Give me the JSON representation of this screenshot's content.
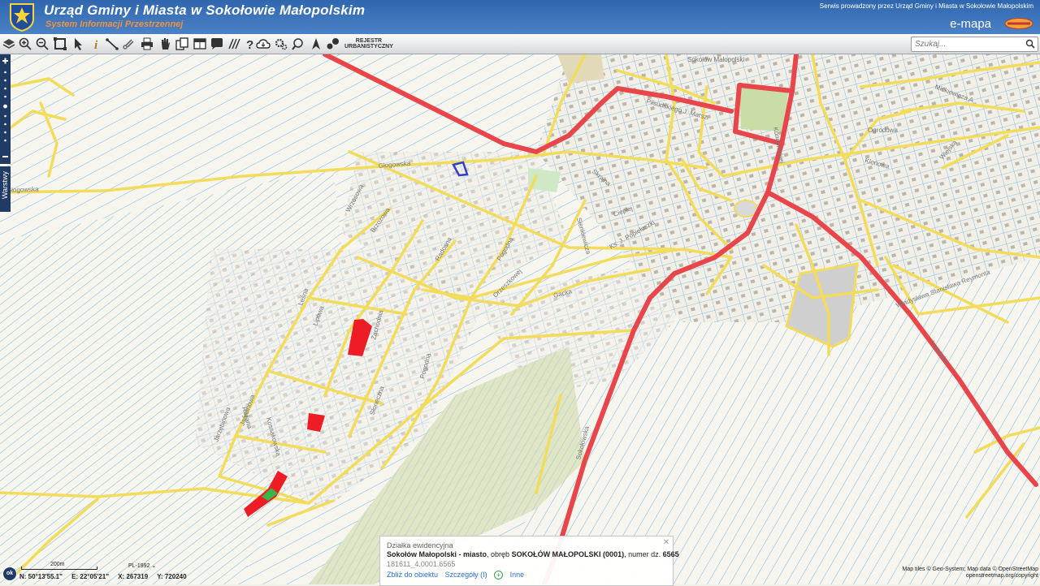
{
  "header": {
    "title": "Urząd Gminy i Miasta w Sokołowie Małopolskim",
    "subtitle": "System Informacji Przestrzennej",
    "service_note": "Serwis prowadzony przez Urząd Gminy i Miasta w Sokołowie Małopolskim",
    "brand": "e-mapa"
  },
  "toolbar": {
    "tools": [
      "layers-icon",
      "zoom-in-icon",
      "zoom-out-icon",
      "zoom-extent-icon",
      "select-arrow-icon",
      "info-icon",
      "measure-distance-icon",
      "link-icon",
      "print-icon",
      "hand-icon",
      "copy-icon",
      "table-icon",
      "comment-icon",
      "hatch-icon",
      "help-icon",
      "cloud-icon",
      "settings-icon",
      "find-icon",
      "compass-icon",
      "notes-icon"
    ],
    "registry_line1": "REJESTR",
    "registry_line2": "URBANISTYCZNY"
  },
  "search": {
    "placeholder": "Szukaj..."
  },
  "side": {
    "layers_label": "Warstwy"
  },
  "map": {
    "street_labels": [
      "Sokołów Małopolski",
      "Głogowska",
      "Głogowska",
      "Wrzosowa",
      "Brzozowa",
      "Leśna",
      "Lipowa",
      "Jaśminowa",
      "Jarzębinowa",
      "Radosna",
      "Zachodnia",
      "Pogodna",
      "Pogodna",
      "Orzeszkowej",
      "Słoneczna",
      "Sienkiewicza",
      "Ciepłej",
      "Skrajna",
      "Ks. J. Popiełuszki",
      "Gacka",
      "Sokołowska",
      "Piłsudskiego J. Marsz.",
      "Mickiewicza A.",
      "Ogrodowa",
      "Klonowa",
      "Władysława Stanisława Reymonta",
      "Różana",
      "Kossakowska",
      "Wiejska",
      "Lwowska",
      "Konopnickiej"
    ],
    "parcel_id": "181611_4.0001.6565"
  },
  "popup": {
    "title": "Działka ewidencyjna",
    "desc_part1": "Sokołów Małopolski - miasto",
    "desc_part2": ", obręb ",
    "desc_part3": "SOKOŁÓW MAŁOPOLSKI (0001)",
    "desc_part4": ", numer dz. ",
    "desc_part5": "6565",
    "id": "181611_4.0001.6565",
    "link_zoom": "Zbliż do obiektu",
    "link_details": "Szczegóły (I)",
    "link_other": "Inne"
  },
  "status": {
    "scale": "200m",
    "crs": "PL-1992",
    "lat": "N: 50°13'55.1\"",
    "lon": "E: 22°05'21\"",
    "x": "X: 267319",
    "y": "Y: 720240",
    "ok": "ok"
  },
  "attribution": {
    "line1": "Map tiles © Geo-System; Map data © OpenStreetMap",
    "line2": "openstreetmap.org/copyright"
  },
  "colors": {
    "header": "#3a72b8",
    "subtitle": "#f0923a",
    "road_main": "#e8464a",
    "road_local": "#f2dc5a",
    "parcels": "#58a4e0",
    "selected_parcel": "#2f3fd0",
    "highlight_red": "#ee1c24",
    "highlight_green": "#3bb54a"
  }
}
